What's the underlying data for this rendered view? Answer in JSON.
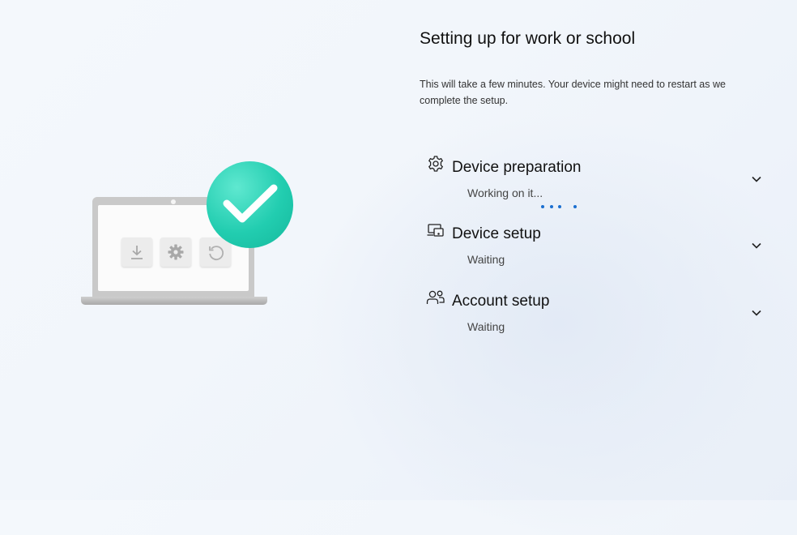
{
  "page": {
    "title": "Setting up for work or school",
    "description": "This will take a few minutes. Your device might need to restart as we complete the setup."
  },
  "illustration": {
    "icons": [
      "download-icon",
      "gear-icon",
      "refresh-icon",
      "checkmark-icon"
    ],
    "check_color": "#22cdb0"
  },
  "steps": [
    {
      "icon": "gear-icon",
      "title": "Device preparation",
      "status": "Working on it..."
    },
    {
      "icon": "devices-icon",
      "title": "Device setup",
      "status": "Waiting"
    },
    {
      "icon": "people-icon",
      "title": "Account setup",
      "status": "Waiting"
    }
  ],
  "progress_dots_color": "#1b6fd0"
}
